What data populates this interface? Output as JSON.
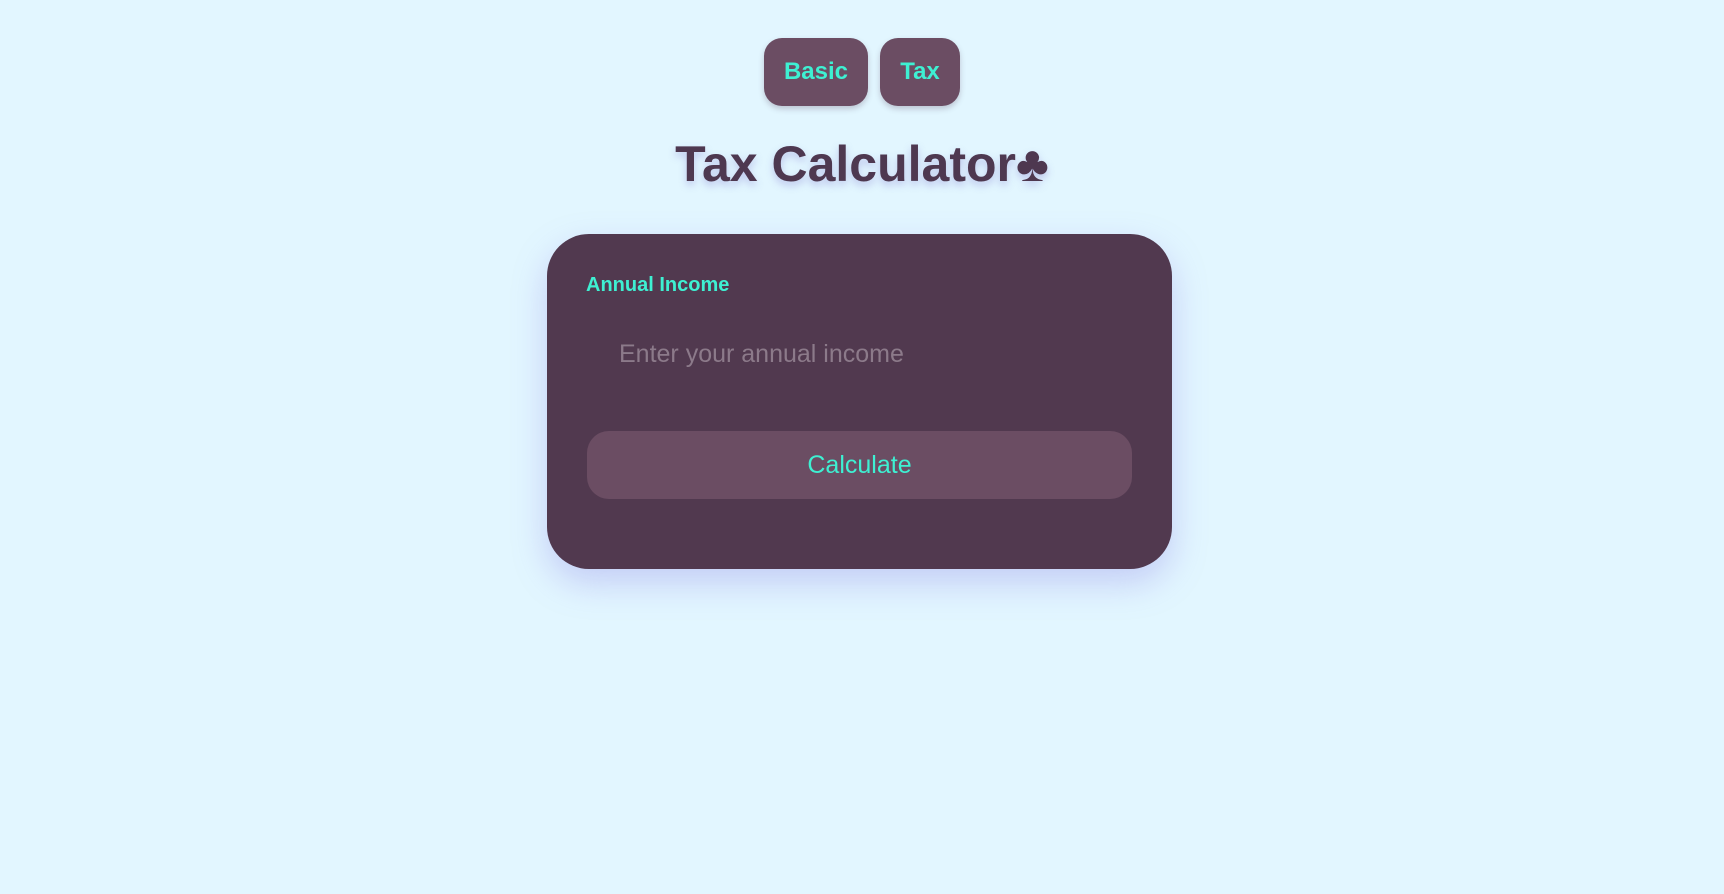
{
  "mode_tabs": {
    "basic_label": "Basic",
    "tax_label": "Tax"
  },
  "header": {
    "title": "Tax Calculator♣"
  },
  "form": {
    "income_label": "Annual Income",
    "income_placeholder": "Enter your annual income",
    "income_value": "",
    "calculate_label": "Calculate"
  },
  "colors": {
    "background": "#e2f6ff",
    "card": "#51394f",
    "button": "#6b4d63",
    "accent_text": "#3ef0d2",
    "title_text": "#4e3850"
  }
}
